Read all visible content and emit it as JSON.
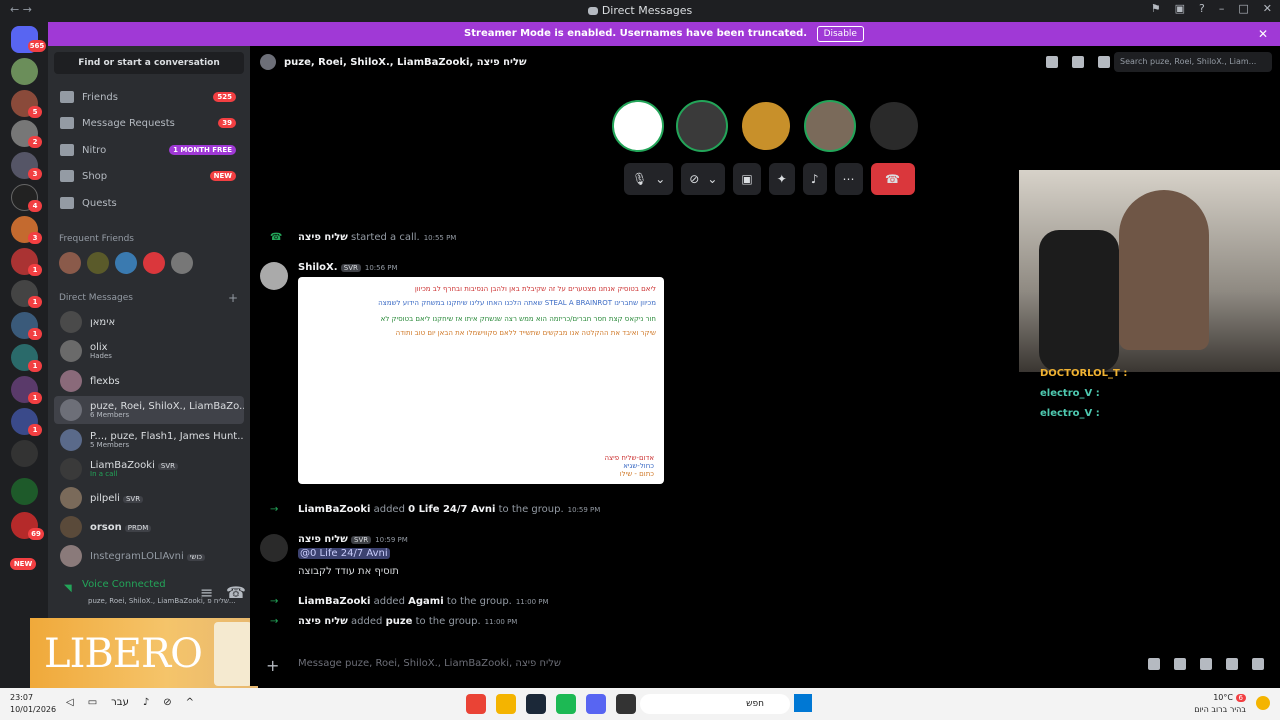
{
  "window": {
    "title": "Direct Messages"
  },
  "banner": {
    "text": "Streamer Mode is enabled. Usernames have been truncated.",
    "button": "Disable"
  },
  "sidebar": {
    "find": "Find or start a conversation",
    "nav": [
      {
        "label": "Friends",
        "badge": "525"
      },
      {
        "label": "Message Requests",
        "badge": "39"
      },
      {
        "label": "Nitro",
        "badge": "1 MONTH FREE"
      },
      {
        "label": "Shop",
        "badge": "NEW"
      },
      {
        "label": "Quests",
        "badge": ""
      }
    ],
    "frequent_friends": "Frequent Friends",
    "direct_messages": "Direct Messages",
    "dms": [
      {
        "name": "אימאן",
        "sub": "",
        "tag": ""
      },
      {
        "name": "olix",
        "sub": "Hades",
        "tag": ""
      },
      {
        "name": "flexbs",
        "sub": "",
        "tag": ""
      },
      {
        "name": "puze, Roei, ShiloX., LiamBaZo...",
        "sub": "6 Members",
        "tag": ""
      },
      {
        "name": "P..., puze, Flash1, James Hunt...",
        "sub": "5 Members",
        "tag": ""
      },
      {
        "name": "LiamBaZooki",
        "sub": "In a call",
        "tag": "SVR"
      },
      {
        "name": "pilpeli",
        "sub": "",
        "tag": "SVR"
      },
      {
        "name": "orson",
        "sub": "",
        "tag": "PRDM"
      },
      {
        "name": "InstegramLOLIAvni",
        "sub": "",
        "tag": "כושי"
      }
    ],
    "voice": {
      "status": "Voice Connected",
      "channel": "puze, Roei, ShiloX., LiamBaZooki, שליח פ..."
    },
    "ad": {
      "text": "LIBERO"
    }
  },
  "guild_badges": [
    "565",
    "5",
    "2",
    "3",
    "4",
    "3",
    "1",
    "1",
    "1",
    "1",
    "1",
    "1",
    "69",
    "NEW"
  ],
  "chat": {
    "name": "puze, Roei, ShiloX., LiamBaZooki, שליח פיצה",
    "search_placeholder": "Search puze, Roei, ShiloX., Liam...",
    "messages": {
      "call": {
        "user": "שליח פיצה",
        "action": "started a call.",
        "time": "10:55 PM"
      },
      "shilo": {
        "user": "ShiloX.",
        "tag": "SVR",
        "time": "10:56 PM"
      },
      "added1": {
        "user": "LiamBaZooki",
        "action": "added",
        "target": "0 Life 24/7 Avni",
        "suffix": "to the group.",
        "time": "10:59 PM"
      },
      "pizza": {
        "user": "שליח פיצה",
        "tag": "SVR",
        "time": "10:59 PM",
        "mention": "@0 Life 24/7 Avni",
        "text": "תוסיף את עודד לקבוצה"
      },
      "added2": {
        "user": "LiamBaZooki",
        "action": "added",
        "target": "Agami",
        "suffix": "to the group.",
        "time": "11:00 PM"
      },
      "added3": {
        "user": "שליח פיצה",
        "action": "added",
        "target": "puze",
        "suffix": "to the group.",
        "time": "11:00 PM"
      }
    },
    "image_lines": [
      "ליאם בטוסיק אנחנו מצטערים על זה שקיבלת באן ולהבן הנסיבות ובחרף לב מכיוון",
      "שאתה הלכנו האחו עלינו שיחקנו במשחק הידוע לשמצה STEAL A BRAINROT מכיוון שחברינו",
      "חור ניקאס קצת חסר חברים/כריזמה הוא ממש רצה שנשחק איתו אז שיחקנו ליאם בטוסיק לא",
      "שיקר ואיבד את ההקלטה אנו מבקשים שתשייד ללאם סקווישמלו את הבאן יום טוב ותודה"
    ],
    "image_sig": [
      "אדום-שליח פיצה",
      "כחול-שגיא",
      "כתום - שילו"
    ],
    "composer_placeholder": "Message puze, Roei, ShiloX., LiamBaZooki, שליח פיצה"
  },
  "twitch_chat": [
    {
      "user": "DOCTORLOL_T :",
      "color": "#f0b232"
    },
    {
      "user": "electro_V :",
      "color": "#4ec9b0"
    },
    {
      "user": "electro_V :",
      "color": "#4ec9b0"
    }
  ],
  "taskbar": {
    "time": "23:07",
    "date": "10/01/2026",
    "lang": "עבר",
    "search": "חפש",
    "temp": "10°C",
    "weather": "בהיר ברוב היום",
    "weather_badge": "6"
  }
}
